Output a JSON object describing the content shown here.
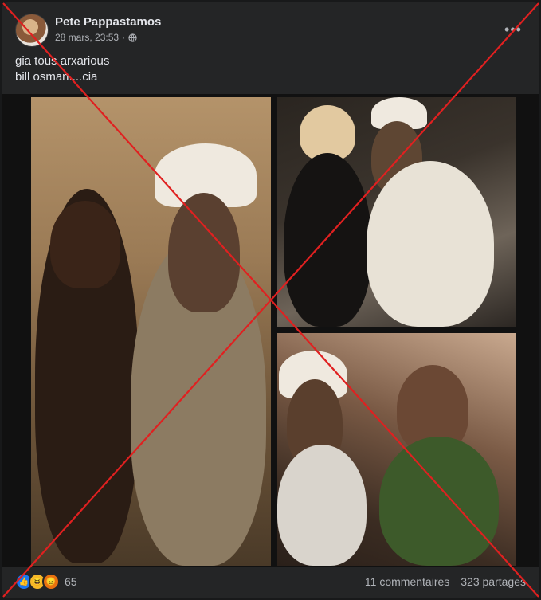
{
  "post": {
    "author": "Pete Pappastamos",
    "timestamp": "28 mars, 23:53",
    "privacy_icon": "globe-icon",
    "more_icon": "more-options-icon",
    "text_lines": [
      "gia tous arxarious",
      "bill osman....cia"
    ]
  },
  "footer": {
    "reaction_icons": [
      "like-icon",
      "haha-icon",
      "angry-icon"
    ],
    "reaction_count": "65",
    "comments": "11 commentaires",
    "shares": "323 partages"
  },
  "overlay": {
    "cross_color": "#e02020"
  }
}
